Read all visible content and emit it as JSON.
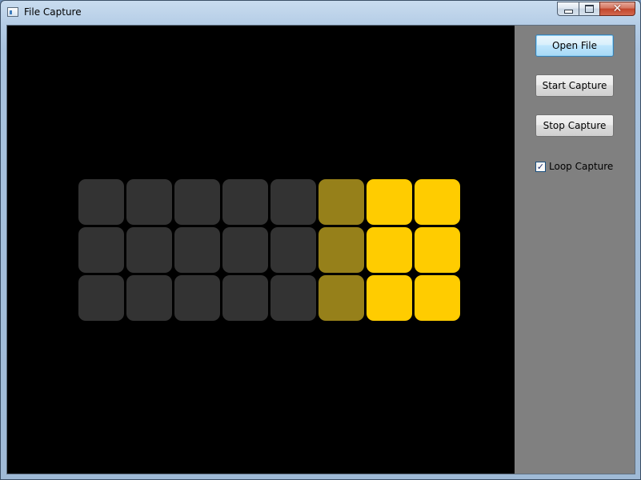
{
  "window": {
    "title": "File Capture",
    "close_glyph": "✕"
  },
  "side_panel": {
    "open_file_label": "Open File",
    "start_capture_label": "Start Capture",
    "stop_capture_label": "Stop Capture",
    "loop_capture_label": "Loop Capture",
    "loop_capture_checked": true,
    "check_glyph": "✓"
  },
  "capture_grid": {
    "rows": 3,
    "columns": 8,
    "colors": {
      "off": "#333333",
      "dim": "#96801a",
      "lit": "#ffcc00"
    },
    "cells": [
      [
        "off",
        "off",
        "off",
        "off",
        "off",
        "dim",
        "lit",
        "lit"
      ],
      [
        "off",
        "off",
        "off",
        "off",
        "off",
        "dim",
        "lit",
        "lit"
      ],
      [
        "off",
        "off",
        "off",
        "off",
        "off",
        "dim",
        "lit",
        "lit"
      ]
    ]
  }
}
